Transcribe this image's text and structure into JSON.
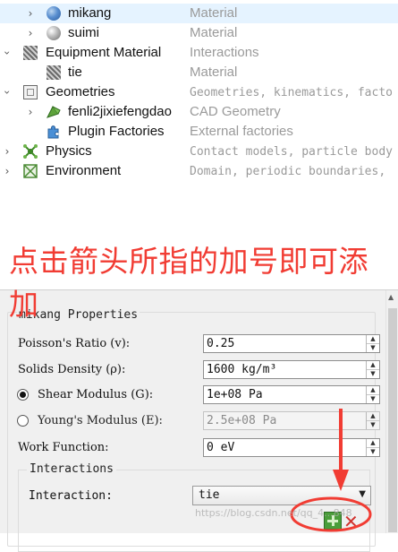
{
  "tree": {
    "items": [
      {
        "name": "mikang",
        "desc": "Material",
        "icon": "material-sphere-icon",
        "selected": true
      },
      {
        "name": "suimi",
        "desc": "Material",
        "icon": "material-sphere-grey-icon"
      },
      {
        "name": "Equipment Material",
        "desc": "Interactions",
        "icon": "hatched-square-icon"
      },
      {
        "name": "tie",
        "desc": "Material",
        "icon": "hatched-square-icon"
      },
      {
        "name": "Geometries",
        "desc": "Geometries, kinematics, facto",
        "icon": "geometry-box-icon"
      },
      {
        "name": "fenli2jixiefengdao",
        "desc": "CAD Geometry",
        "icon": "cad-geometry-icon"
      },
      {
        "name": "Plugin Factories",
        "desc": "External factories",
        "icon": "puzzle-piece-icon"
      },
      {
        "name": "Physics",
        "desc": "Contact models, particle body",
        "icon": "physics-icon"
      },
      {
        "name": "Environment",
        "desc": "Domain, periodic boundaries,",
        "icon": "environment-icon"
      }
    ]
  },
  "annotation": {
    "text": "点击箭头所指的加号即可添加",
    "color": "#f13c33"
  },
  "properties": {
    "title": "mikang Properties",
    "poisson_label": "Poisson's Ratio (v):",
    "poisson_value": "0.25",
    "density_label": "Solids Density (ρ):",
    "density_value": "1600 kg/m³",
    "shear_label": "Shear Modulus (G):",
    "shear_value": "1e+08 Pa",
    "young_label": "Young's Modulus (E):",
    "young_value": "2.5e+08 Pa",
    "work_label": "Work Function:",
    "work_value": "0 eV",
    "interactions_title": "Interactions",
    "interaction_label": "Interaction:",
    "interaction_value": "tie"
  },
  "watermark": "https://blog.csdn.net/qq_4...848"
}
